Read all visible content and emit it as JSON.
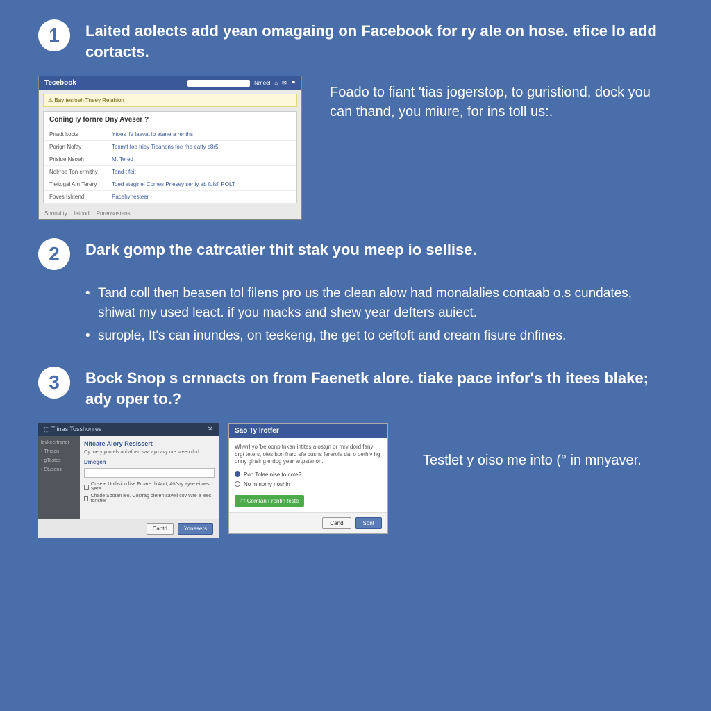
{
  "step1": {
    "num": "1",
    "text": "Laited aolects add yean omagaing on Facebook for ry ale on hose. efice lo add cortacts.",
    "side": "Foado to fiant 'tias jogerstop, to guristiond, dock you can thand, you miure, for ins toll us:."
  },
  "step2": {
    "num": "2",
    "text": "Dark gomp the catrcatier thit stak you meep io sellise.",
    "bullets": [
      "Tand coll then beasen tol filens pro us the clean alow had monalalies contaab o.s cundates, shiwat my used leact. if you macks and shew year defters auiect.",
      "surople, It's can inundes, on teekeng, the get to ceftoft and cream fisure dnfines."
    ]
  },
  "step3": {
    "num": "3",
    "text": "Bock Snop s crnnacts on from Faenetk alore. tiake pace infor's th itees blake; ady oper to.?",
    "side": "Testlet y oiso me into (° in mnyaver."
  },
  "mock1": {
    "brand": "Tecebook",
    "topbar_right": [
      "Nmeel",
      "⌂",
      "✉",
      "⚑"
    ],
    "banner": "⚠ Bay tesfoeh Tneey Relahion",
    "panel_title": "Coning Iy fornre Dny Aveser ?",
    "rows": [
      {
        "k": "Pnadt itocts",
        "v": "Ytoes ife laavat lo atanera renths"
      },
      {
        "k": "Porign Noftty",
        "v": "Texmtt foe triey Tieahons foe rhe eatty c8r5"
      },
      {
        "k": "Prisiue Nsoeh",
        "v": "Mt Tered"
      },
      {
        "k": "Nolrroe Ton ermithy",
        "v": "Tand t feit"
      },
      {
        "k": "Tleitogal Am Terery",
        "v": "Toed ateginel Comes Priesey sertiy ab fuisfi POLT"
      },
      {
        "k": "Foves Ishtend",
        "v": "Pacehyhesteer"
      }
    ],
    "footer": [
      "Snnovi ty",
      "latood",
      "Porensosteos"
    ]
  },
  "mock2": {
    "title": "⬚ T inas Tosshonres",
    "close": "✕",
    "side": [
      "lovkeertroner",
      "• Thrson",
      "• gTostes",
      "• Stusens"
    ],
    "heading": "Nitcare Alory Reslssert",
    "sub": "Oy toery you els aol afoed saa ayn avy ore sreeo dnd",
    "sect": "Dmegen",
    "chk1": "Onsete Unthsion lise Frpare rh Aort, 4tVsry ayse ei aes Sere",
    "chk2": "Chade Sbotan ieo. Costrag oiereh savell cov Wre e lees tonstier",
    "cancel": "Cantd",
    "ok": "Yonesers"
  },
  "mock3": {
    "title": "Sao Ty lrotfer",
    "para": "Whwrl yo 'be oonp tnkan intites a ostgn or mry dord fany brgt teters, oies bon frard sfe bushs fererole dal o oethiv hg onny ginsing erdog year artpstanon.",
    "radio1": "Pon Tolae nise to cote?",
    "radio2": "No m nomy noshin",
    "green": "⬚ Comtan Frontin feste",
    "cancel": "Cand",
    "send": "Sont"
  }
}
